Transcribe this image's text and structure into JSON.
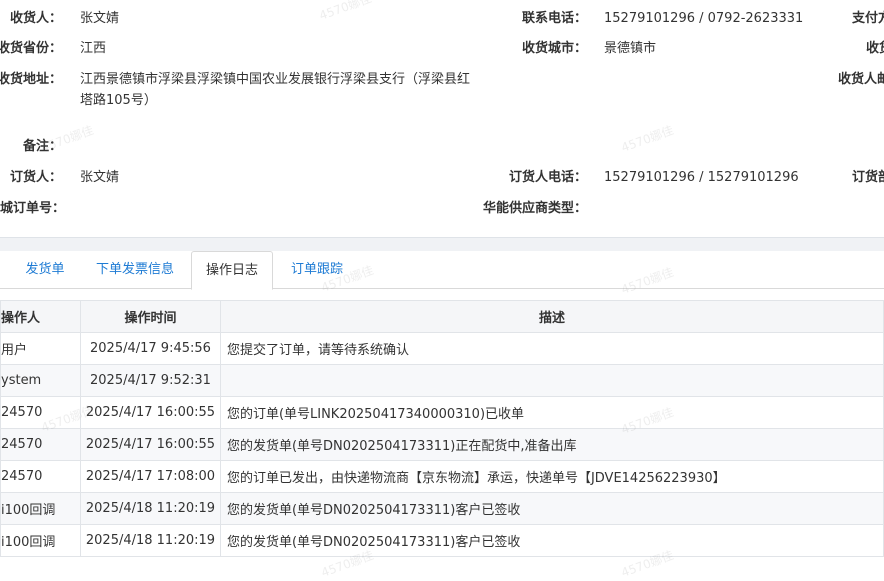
{
  "order_info": {
    "consignee_label": "收货人：",
    "consignee_value": "张文婧",
    "phone_label": "联系电话：",
    "phone_value": "15279101296 / 0792-2623331",
    "pay_label_partial": "支付方",
    "province_label": "收货省份：",
    "province_value": "江西",
    "city_label": "收货城市：",
    "city_value": "景德镇市",
    "col3_row2_partial": "收货",
    "address_label": "收货地址：",
    "address_value": "江西景德镇市浮梁县浮梁镇中国农业发展银行浮梁县支行（浮梁县红塔路105号）",
    "col3_row3_partial": "收货人邮",
    "remark_label": "备注：",
    "remark_value": "",
    "orderer_label": "订货人：",
    "orderer_value": "张文婧",
    "orderer_phone_label": "订货人电话：",
    "orderer_phone_value": "15279101296 / 15279101296",
    "col3_row5_partial": "订货部",
    "mall_order_label": "城订单号：",
    "mall_order_value": "",
    "supplier_type_label": "华能供应商类型：",
    "supplier_type_value": ""
  },
  "tabs": [
    {
      "label": "发货单"
    },
    {
      "label": "下单发票信息"
    },
    {
      "label": "操作日志"
    },
    {
      "label": "订单跟踪"
    }
  ],
  "active_tab": "操作日志",
  "log_table": {
    "headers": [
      "操作人",
      "操作时间",
      "描述"
    ],
    "rows": [
      {
        "operator": "用户",
        "time": "2025/4/17 9:45:56",
        "desc": "您提交了订单，请等待系统确认"
      },
      {
        "operator": "ystem",
        "time": "2025/4/17 9:52:31",
        "desc": ""
      },
      {
        "operator": "24570",
        "time": "2025/4/17 16:00:55",
        "desc": "您的订单(单号LINK20250417340000310)已收单"
      },
      {
        "operator": "24570",
        "time": "2025/4/17 16:00:55",
        "desc": "您的发货单(单号DN0202504173311)正在配货中,准备出库"
      },
      {
        "operator": "24570",
        "time": "2025/4/17 17:08:00",
        "desc": "您的订单已发出，由快递物流商【京东物流】承运，快递单号【JDVE14256223930】"
      },
      {
        "operator": "i100回调",
        "time": "2025/4/18 11:20:19",
        "desc": "您的发货单(单号DN0202504173311)客户已签收"
      },
      {
        "operator": "i100回调",
        "time": "2025/4/18 11:20:19",
        "desc": "您的发货单(单号DN0202504173311)客户已签收"
      }
    ]
  },
  "watermark_text": "4570娜佳",
  "colors": {
    "accent": "#1e7bd4",
    "header_bg": "#f5f6f8",
    "border": "#e1e4e8"
  }
}
